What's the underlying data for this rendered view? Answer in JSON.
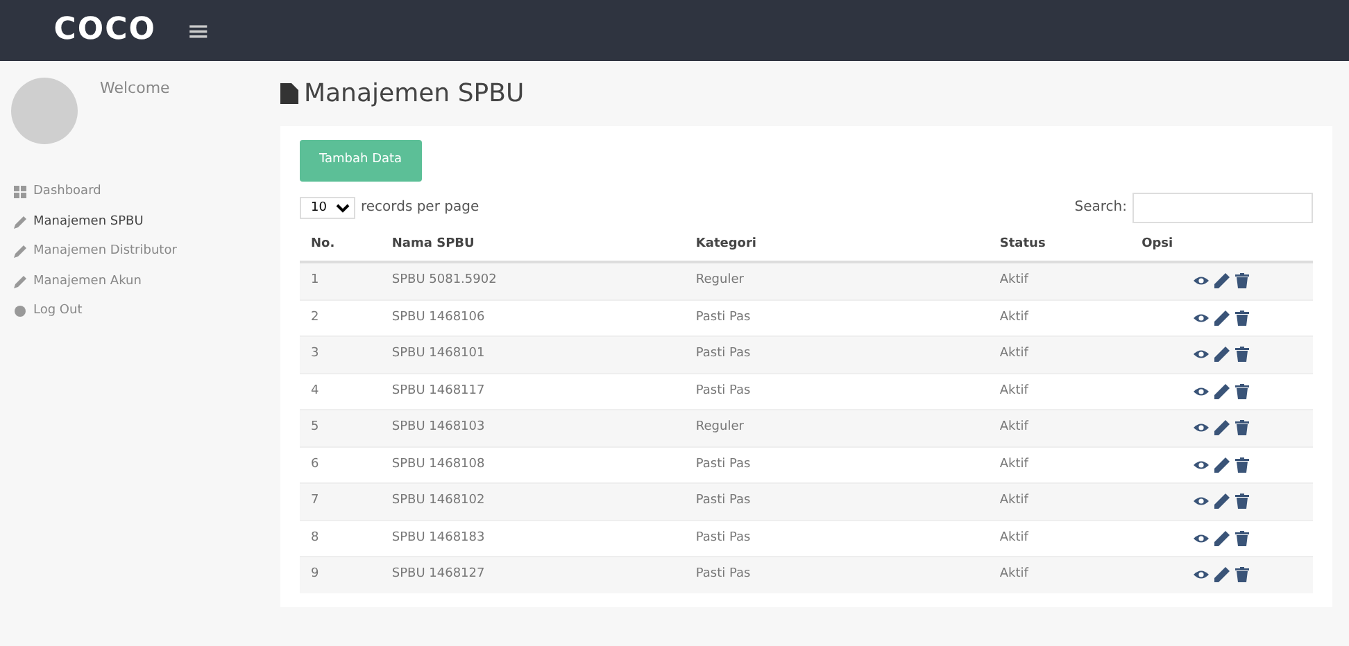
{
  "navbar": {
    "logo": "COCO",
    "menu_toggle": "≡"
  },
  "sidebar": {
    "greeting": "Welcome",
    "items": [
      {
        "label": "Dashboard",
        "kind": "dashboard",
        "selected": false
      },
      {
        "label": "Manajemen SPBU",
        "kind": "link",
        "selected": true
      },
      {
        "label": "Manajemen Distributor",
        "kind": "link",
        "selected": false
      },
      {
        "label": "Manajemen Akun",
        "kind": "link",
        "selected": false
      },
      {
        "label": "Log Out",
        "kind": "logout",
        "selected": false
      }
    ]
  },
  "page": {
    "title": "Manajemen SPBU",
    "add_button": "Tambah Data",
    "page_size": "10",
    "page_size_suffix": "records per page",
    "search_label": "Search:",
    "table": {
      "columns": [
        "No.",
        "Nama SPBU",
        "Kategori",
        "Status",
        "Opsi"
      ],
      "rows": [
        {
          "no": "1",
          "name": "SPBU 5081.5902",
          "category": "Reguler",
          "status": "Aktif"
        },
        {
          "no": "2",
          "name": "SPBU 1468106",
          "category": "Pasti Pas",
          "status": "Aktif"
        },
        {
          "no": "3",
          "name": "SPBU 1468101",
          "category": "Pasti Pas",
          "status": "Aktif"
        },
        {
          "no": "4",
          "name": "SPBU 1468117",
          "category": "Pasti Pas",
          "status": "Aktif"
        },
        {
          "no": "5",
          "name": "SPBU 1468103",
          "category": "Reguler",
          "status": "Aktif"
        },
        {
          "no": "6",
          "name": "SPBU 1468108",
          "category": "Pasti Pas",
          "status": "Aktif"
        },
        {
          "no": "7",
          "name": "SPBU 1468102",
          "category": "Pasti Pas",
          "status": "Aktif"
        },
        {
          "no": "8",
          "name": "SPBU 1468183",
          "category": "Pasti Pas",
          "status": "Aktif"
        },
        {
          "no": "9",
          "name": "SPBU 1468127",
          "category": "Pasti Pas",
          "status": "Aktif"
        }
      ]
    }
  }
}
